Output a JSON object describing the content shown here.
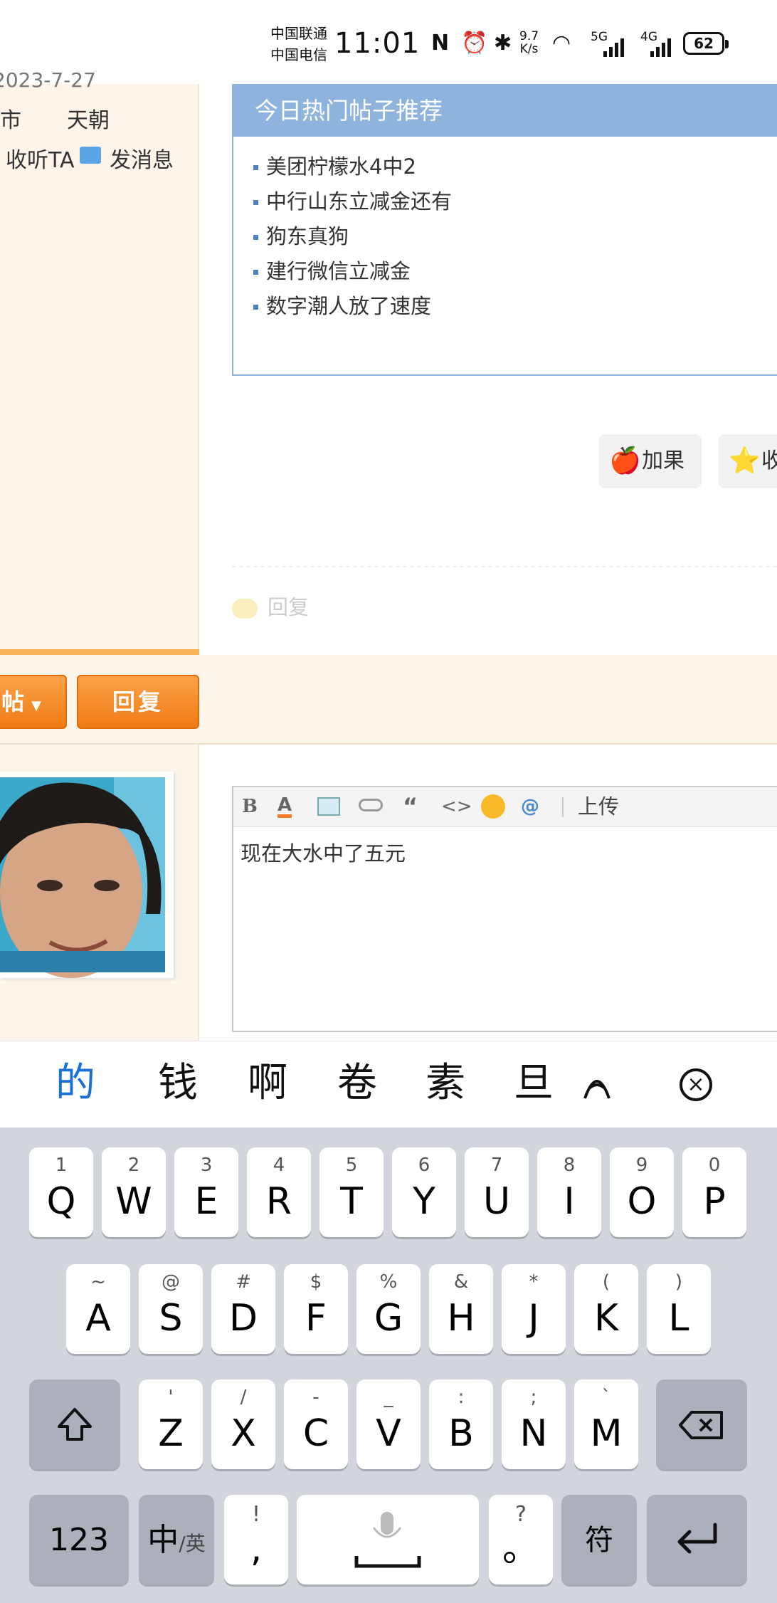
{
  "status_bar": {
    "carrier_1": "中国联通",
    "carrier_2": "中国电信",
    "time": "11:01",
    "net_speed_value": "9.7",
    "net_speed_unit": "K/s",
    "sim1": "5G",
    "sim2": "4G",
    "battery": "62",
    "icons": [
      "nfc-icon",
      "alarm-icon",
      "bluetooth-icon",
      "wifi-icon",
      "signal-icon",
      "battery-icon"
    ]
  },
  "profile": {
    "reg_partial": "2023-7-27",
    "city_label": "市",
    "city_value": "天朝",
    "follow": "收听TA",
    "message": "发消息"
  },
  "hot_posts": {
    "title": "今日热门帖子推荐",
    "items": [
      "美团柠檬水4中2",
      "中行山东立减金还有",
      "狗东真狗",
      "建行微信立减金",
      "数字潮人放了速度"
    ]
  },
  "actions": {
    "add_fruit": "加果",
    "favorite": "收",
    "reply_link": "回复"
  },
  "post_bar": {
    "new_post": "帖",
    "reply": "回复"
  },
  "editor": {
    "toolbar": [
      "B",
      "A",
      "image",
      "link",
      "“",
      "<>",
      "emoji",
      "@"
    ],
    "upload": "上传",
    "content": "现在大水中了五元"
  },
  "ime": {
    "candidates": [
      "的",
      "钱",
      "啊",
      "卷",
      "素",
      "旦"
    ],
    "row1": [
      [
        "1",
        "Q"
      ],
      [
        "2",
        "W"
      ],
      [
        "3",
        "E"
      ],
      [
        "4",
        "R"
      ],
      [
        "5",
        "T"
      ],
      [
        "6",
        "Y"
      ],
      [
        "7",
        "U"
      ],
      [
        "8",
        "I"
      ],
      [
        "9",
        "O"
      ],
      [
        "0",
        "P"
      ]
    ],
    "row2": [
      [
        "~",
        "A"
      ],
      [
        "@",
        "S"
      ],
      [
        "#",
        "D"
      ],
      [
        "$",
        "F"
      ],
      [
        "%",
        "G"
      ],
      [
        "&",
        "H"
      ],
      [
        "*",
        "J"
      ],
      [
        "(",
        "K"
      ],
      [
        ")",
        "L"
      ]
    ],
    "row3": [
      [
        "'",
        "Z"
      ],
      [
        "/",
        "X"
      ],
      [
        "-",
        "C"
      ],
      [
        "_",
        "V"
      ],
      [
        ":",
        "B"
      ],
      [
        ";",
        "N"
      ],
      [
        "`",
        "M"
      ]
    ],
    "num_key": "123",
    "lang_key_main": "中",
    "lang_key_sub": "/英",
    "comma_top": "!",
    "comma_main": ",",
    "period_top": "?",
    "period_main": "。",
    "symbol_key": "符"
  },
  "colors": {
    "hot_header": "#8eb4de",
    "orange_button": "#f48a25",
    "candidate_highlight": "#1a6fd8",
    "sidebar_bg": "#fdf5e9",
    "keyboard_bg": "#d2d5db"
  }
}
